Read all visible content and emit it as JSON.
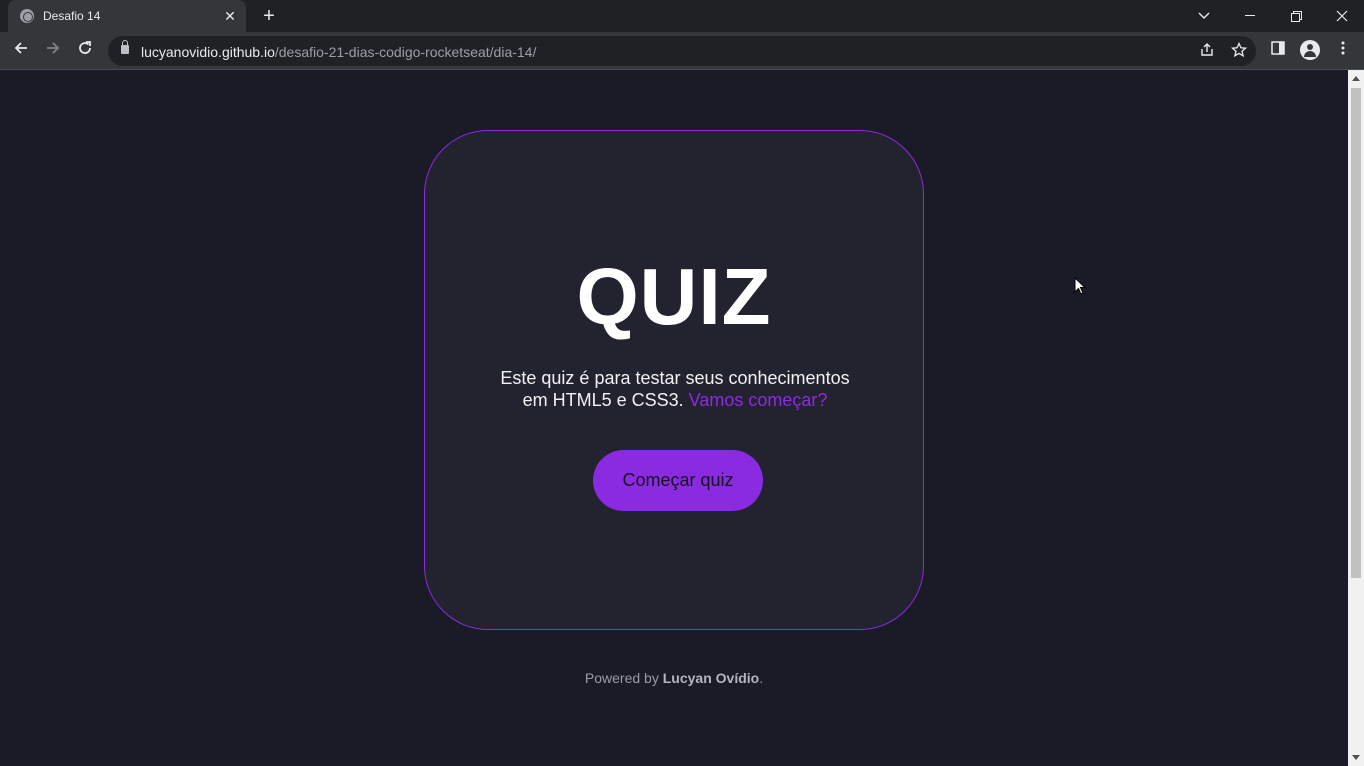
{
  "browser": {
    "tab_title": "Desafio 14",
    "url_host": "lucyanovidio.github.io",
    "url_path": "/desafio-21-dias-codigo-rocketseat/dia-14/"
  },
  "card": {
    "title": "QUIZ",
    "description_line1": "Este quiz é para testar seus conhecimentos",
    "description_line2": "em HTML5 e CSS3.",
    "description_accent": "Vamos começar?",
    "button_label": "Começar quiz"
  },
  "footer": {
    "prefix": "Powered by",
    "author": "Lucyan Ovídio",
    "suffix": "."
  },
  "colors": {
    "background": "#1b1b27",
    "card": "#23222f",
    "accent": "#8a2be2"
  }
}
